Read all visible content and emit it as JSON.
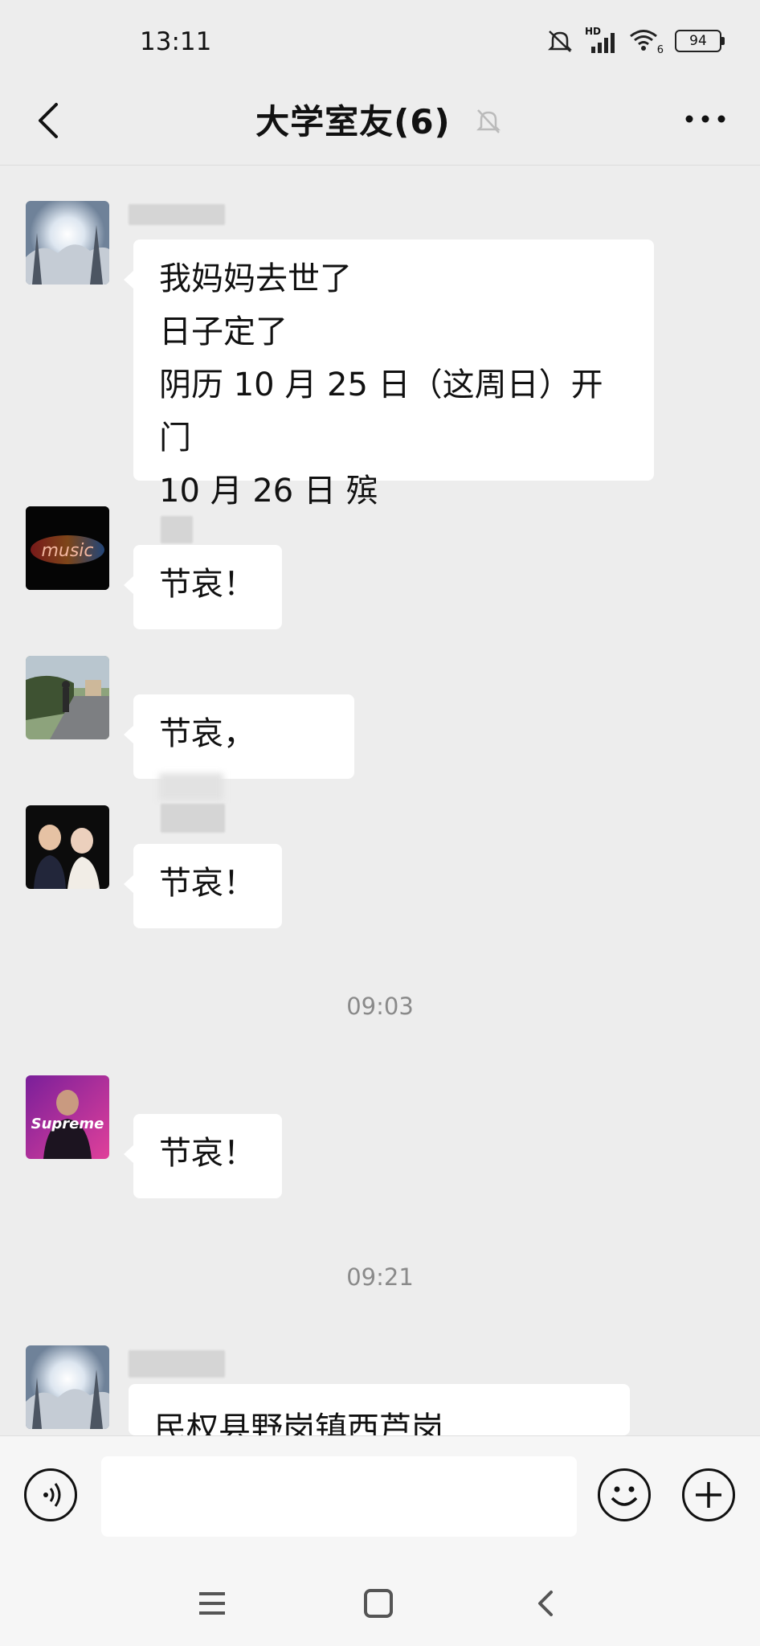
{
  "status_bar": {
    "time": "13:11",
    "signal": "HD",
    "wifi_badge": "6",
    "battery": "94"
  },
  "header": {
    "title": "大学室友(6)"
  },
  "messages": [
    {
      "lines": [
        "我妈妈去世了",
        "日子定了",
        "阴历 10 月 25 日（这周日）开门",
        "10 月 26 日  殡"
      ]
    },
    {
      "text": "节哀！"
    },
    {
      "text": "节哀，"
    },
    {
      "text": "节哀！"
    },
    {
      "text": "节哀！"
    },
    {
      "text": "民权县野岗镇西芦岗"
    }
  ],
  "avatars": [
    {
      "icon": "snowy-sunrise-avatar"
    },
    {
      "icon": "neon-light-avatar",
      "text": "music"
    },
    {
      "icon": "road-walker-avatar"
    },
    {
      "icon": "couple-photo-avatar"
    },
    {
      "icon": "supreme-avatar",
      "text": "Supreme"
    },
    {
      "icon": "snowy-sunrise-avatar"
    }
  ],
  "timestamps": [
    "09:03",
    "09:21"
  ],
  "input": {
    "placeholder": ""
  }
}
